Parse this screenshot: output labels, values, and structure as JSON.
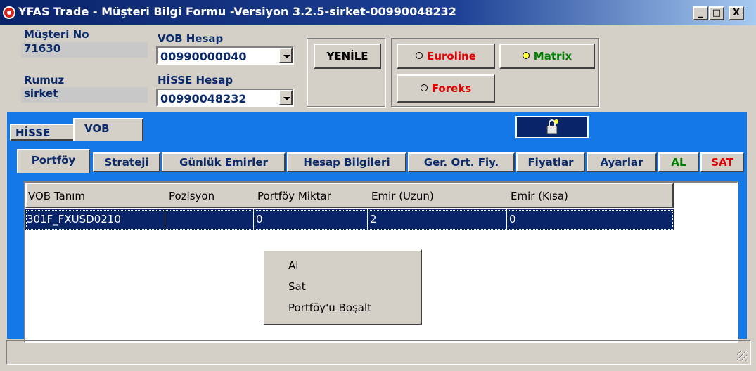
{
  "window": {
    "title": "YFAS Trade - Müşteri Bilgi Formu -Versiyon 3.2.5-sirket-00990048232",
    "controls": {
      "minimize": "_",
      "maximize": "□",
      "close": "X"
    }
  },
  "header": {
    "musteri_no_label": "Müşteri No",
    "musteri_no_value": "71630",
    "rumuz_label": "Rumuz",
    "rumuz_value": "sirket",
    "vob_hesap_label": "VOB Hesap",
    "vob_hesap_value": "00990000040",
    "hisse_hesap_label": "HİSSE Hesap",
    "hisse_hesap_value": "00990048232",
    "refresh_label": "YENİLE",
    "euroline_label": "Euroline",
    "matrix_label": "Matrix",
    "foreks_label": "Foreks"
  },
  "outer_tabs": [
    "HİSSE",
    "VOB"
  ],
  "inner_tabs": [
    "Portföy",
    "Strateji",
    "Günlük Emirler",
    "Hesap Bilgileri",
    "Ger. Ort. Fiy.",
    "Fiyatlar",
    "Ayarlar",
    "AL",
    "SAT"
  ],
  "grid": {
    "columns": [
      "VOB Tanım",
      "Pozisyon",
      "Portföy Miktar",
      "Emir (Uzun)",
      "Emir (Kısa)"
    ],
    "rows": [
      {
        "vob_tanim": "301F_FXUSD0210",
        "pozisyon": "",
        "portfoy_miktar": "0",
        "emir_uzun": "2",
        "emir_kisa": "0"
      }
    ]
  },
  "context_menu": [
    "Al",
    "Sat",
    "Portföy'u Boşalt"
  ],
  "colors": {
    "title_bar": "#0a246a",
    "tab_strip": "#1478e6",
    "selection": "#0a246a",
    "euroline_text": "#e00000",
    "matrix_text": "#008000",
    "foreks_text": "#e00000",
    "al_text": "#008000",
    "sat_text": "#e00000"
  }
}
